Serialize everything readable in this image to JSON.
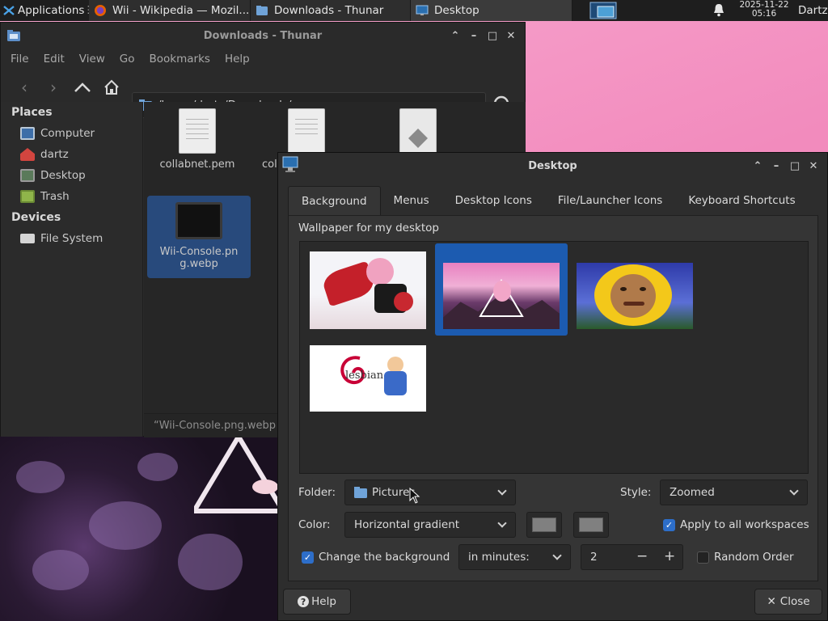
{
  "panel": {
    "applications_label": "Applications",
    "tasks": [
      {
        "label": "Wii - Wikipedia — Mozil...",
        "icon": "firefox-icon"
      },
      {
        "label": "Downloads - Thunar",
        "icon": "folder-icon"
      },
      {
        "label": "Desktop",
        "icon": "desktop-settings-icon"
      }
    ],
    "date": "2025-11-22",
    "time": "05:16",
    "user": "Dartz"
  },
  "thunar": {
    "title": "Downloads - Thunar",
    "menu": [
      "File",
      "Edit",
      "View",
      "Go",
      "Bookmarks",
      "Help"
    ],
    "path": "/home/dartz/Downloads/",
    "places_header": "Places",
    "places": [
      {
        "label": "Computer",
        "icon": "computer-icon"
      },
      {
        "label": "dartz",
        "icon": "home-icon"
      },
      {
        "label": "Desktop",
        "icon": "desktop-icon"
      },
      {
        "label": "Trash",
        "icon": "trash-icon"
      }
    ],
    "devices_header": "Devices",
    "devices": [
      {
        "label": "File System",
        "icon": "drive-icon"
      }
    ],
    "files": [
      {
        "name": "collabnet.pem"
      },
      {
        "name": "col"
      },
      {
        "name": ""
      },
      {
        "name": "Wii-Console.png.webp"
      }
    ],
    "status": "“Wii-Console.png.webp"
  },
  "desktop": {
    "title": "Desktop",
    "tabs": [
      "Background",
      "Menus",
      "Desktop Icons",
      "File/Launcher Icons",
      "Keyboard Shortcuts"
    ],
    "active_tab": "Background",
    "wallpaper_label": "Wallpaper for my desktop",
    "selected_wallpaper_index": 1,
    "folder_label": "Folder:",
    "folder_value": "Pictures",
    "style_label": "Style:",
    "style_value": "Zoomed",
    "color_label": "Color:",
    "color_value": "Horizontal gradient",
    "color_swatches": [
      "#808080",
      "#808080"
    ],
    "apply_all_label": "Apply to all workspaces",
    "apply_all_checked": true,
    "change_bg_label": "Change the background",
    "change_bg_checked": true,
    "interval_value": "in minutes:",
    "interval_number": "2",
    "random_order_label": "Random Order",
    "random_order_checked": false,
    "thumb_text_lesbian": "lesbian",
    "help_label": "Help",
    "close_label": "Close"
  },
  "colors": {
    "accent": "#2d6ec9",
    "selection": "#1c5bb0",
    "panel_bg": "#1e1e1e",
    "window_bg": "#2d2d2d"
  }
}
